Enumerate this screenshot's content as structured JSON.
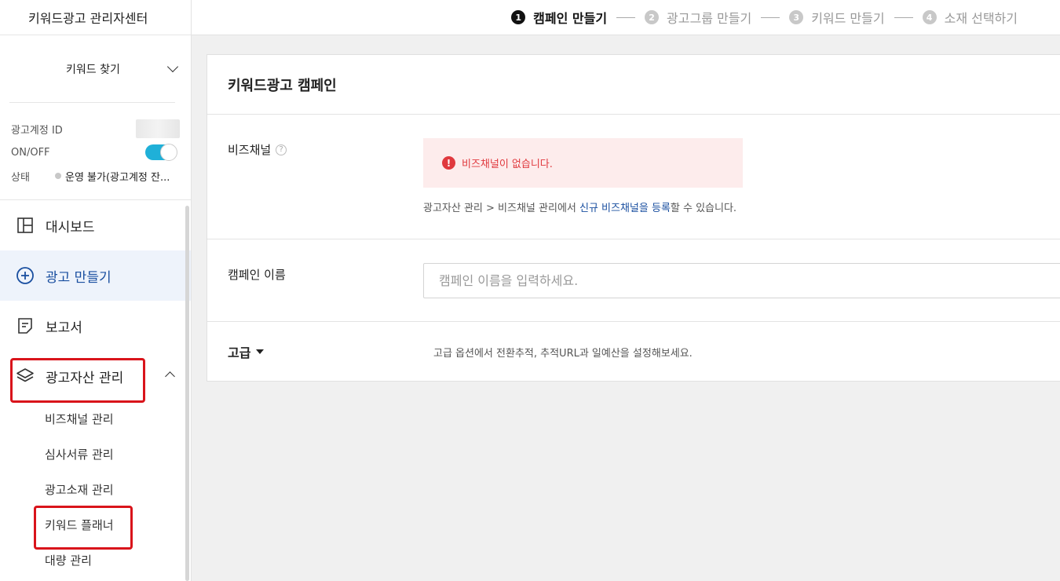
{
  "sidebar": {
    "title": "키워드광고 관리자센터",
    "keyword_find": "키워드 찾기",
    "account": {
      "id_label": "광고계정 ID",
      "onoff_label": "ON/OFF",
      "status_label": "상태",
      "status_value": "운영 불가(광고계정 잔..."
    },
    "nav": {
      "dashboard": "대시보드",
      "create_ad": "광고 만들기",
      "report": "보고서",
      "asset_mgmt": "광고자산 관리"
    },
    "sub_items": [
      "비즈채널 관리",
      "심사서류 관리",
      "광고소재 관리",
      "키워드 플래너",
      "대량 관리"
    ]
  },
  "steps": [
    {
      "num": "1",
      "label": "캠페인 만들기"
    },
    {
      "num": "2",
      "label": "광고그룹 만들기"
    },
    {
      "num": "3",
      "label": "키워드 만들기"
    },
    {
      "num": "4",
      "label": "소재 선택하기"
    }
  ],
  "card": {
    "title": "키워드광고 캠페인",
    "biz_channel_label": "비즈채널",
    "alert_text": "비즈채널이 없습니다.",
    "hint_prefix": "광고자산 관리 > 비즈채널 관리에서 ",
    "hint_link": "신규 비즈채널을 등록",
    "hint_suffix": "할 수 있습니다.",
    "campaign_name_label": "캠페인 이름",
    "campaign_name_placeholder": "캠페인 이름을 입력하세요.",
    "advanced_label": "고급",
    "advanced_desc": "고급 옵션에서 전환추적, 추적URL과 일예산을 설정해보세요."
  },
  "colors": {
    "accent": "#1a4fa0",
    "toggle_on": "#1fb0d8",
    "alert_red": "#e0393e",
    "highlight_box": "#d9141b"
  }
}
